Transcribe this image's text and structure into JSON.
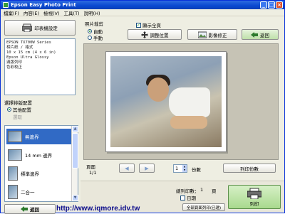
{
  "window": {
    "title": "Epson Easy Photo Print",
    "controls": {
      "minimize": "_",
      "maximize": "□",
      "close": "×"
    }
  },
  "menu": [
    "檔案(F)",
    "內容(E)",
    "檢視(V)",
    "工具(T)",
    "說明(H)"
  ],
  "left": {
    "printer_setup_label": "印表機設定",
    "printer_info": [
      "EPSON TX700W Series",
      "相片紙 / 格式",
      "10 x 15 cm (4 x 6 in)",
      "Epson Ultra Glossy",
      "滿版列印",
      "色彩校正"
    ],
    "layout_label": "選擇排版配置",
    "radio_options": [
      {
        "label": "其他配置",
        "selected": true
      },
      {
        "label": "選取",
        "selected": false
      }
    ],
    "layouts": [
      {
        "label": "無邊界",
        "selected": true
      },
      {
        "label": "14 mm 邊界",
        "selected": false
      },
      {
        "label": "標準邊界",
        "selected": false
      },
      {
        "label": "二合一",
        "selected": false
      }
    ],
    "back_label": "返回"
  },
  "right": {
    "paper_label": "照片裁剪",
    "orientation": [
      {
        "label": "自動",
        "selected": true
      },
      {
        "label": "手動",
        "selected": false
      }
    ],
    "fit_paper_label": "顯示全頁",
    "fit_paper_checked": true,
    "tools": {
      "adjust_position": "調整位置",
      "enhance": "影像修正",
      "return": "返回"
    },
    "page_label": "頁面",
    "page_value": "1/1",
    "copies_value": "1",
    "copies_label": "份數",
    "all_copies_label": "列印份數"
  },
  "bottom": {
    "pages_label": "總列印數：",
    "pages_value": "1",
    "pages_unit": "頁",
    "date_label": "日期",
    "print_label": "列印",
    "print_all_label": "全部頁面列印(已選)"
  },
  "watermark": "http://www.iqmore.idv.tw",
  "colors": {
    "titlebar": "#0a48d0",
    "selection": "#316ac5",
    "print_button": "#a9d98e"
  }
}
